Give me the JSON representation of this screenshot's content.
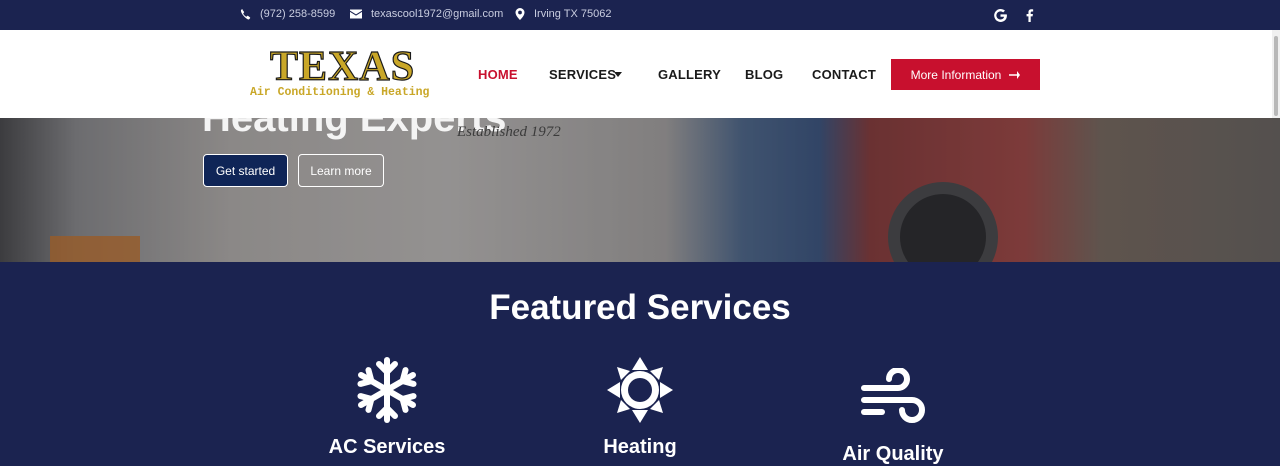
{
  "topbar": {
    "phone": "(972) 258-8599",
    "email": "texascool1972@gmail.com",
    "location": "Irving TX 75062",
    "icons": [
      "phone-icon",
      "envelope-icon",
      "map-pin-icon",
      "google-icon",
      "facebook-icon"
    ]
  },
  "header": {
    "logo": {
      "title": "TEXAS",
      "subtitle": "Air Conditioning & Heating"
    },
    "nav": [
      {
        "label": "HOME",
        "active": true
      },
      {
        "label": "SERVICES",
        "active": false
      },
      {
        "label": "GALLERY",
        "active": false
      },
      {
        "label": "BLOG",
        "active": false
      },
      {
        "label": "CONTACT",
        "active": false
      }
    ],
    "cta_label": "More Information"
  },
  "hero": {
    "heading": "Heating Experts",
    "van_text": "Established 1972",
    "primary_button": "Get started",
    "secondary_button": "Learn more"
  },
  "featured": {
    "title": "Featured Services",
    "services": [
      {
        "label": "AC Services",
        "icon": "snowflake-icon"
      },
      {
        "label": "Heating",
        "icon": "sun-icon"
      },
      {
        "label": "Air Quality",
        "icon": "wind-icon"
      }
    ]
  },
  "colors": {
    "navy": "#1b2350",
    "accent_red": "#c8102e",
    "logo_gold": "#c9a728",
    "primary_button": "#0f2557"
  }
}
